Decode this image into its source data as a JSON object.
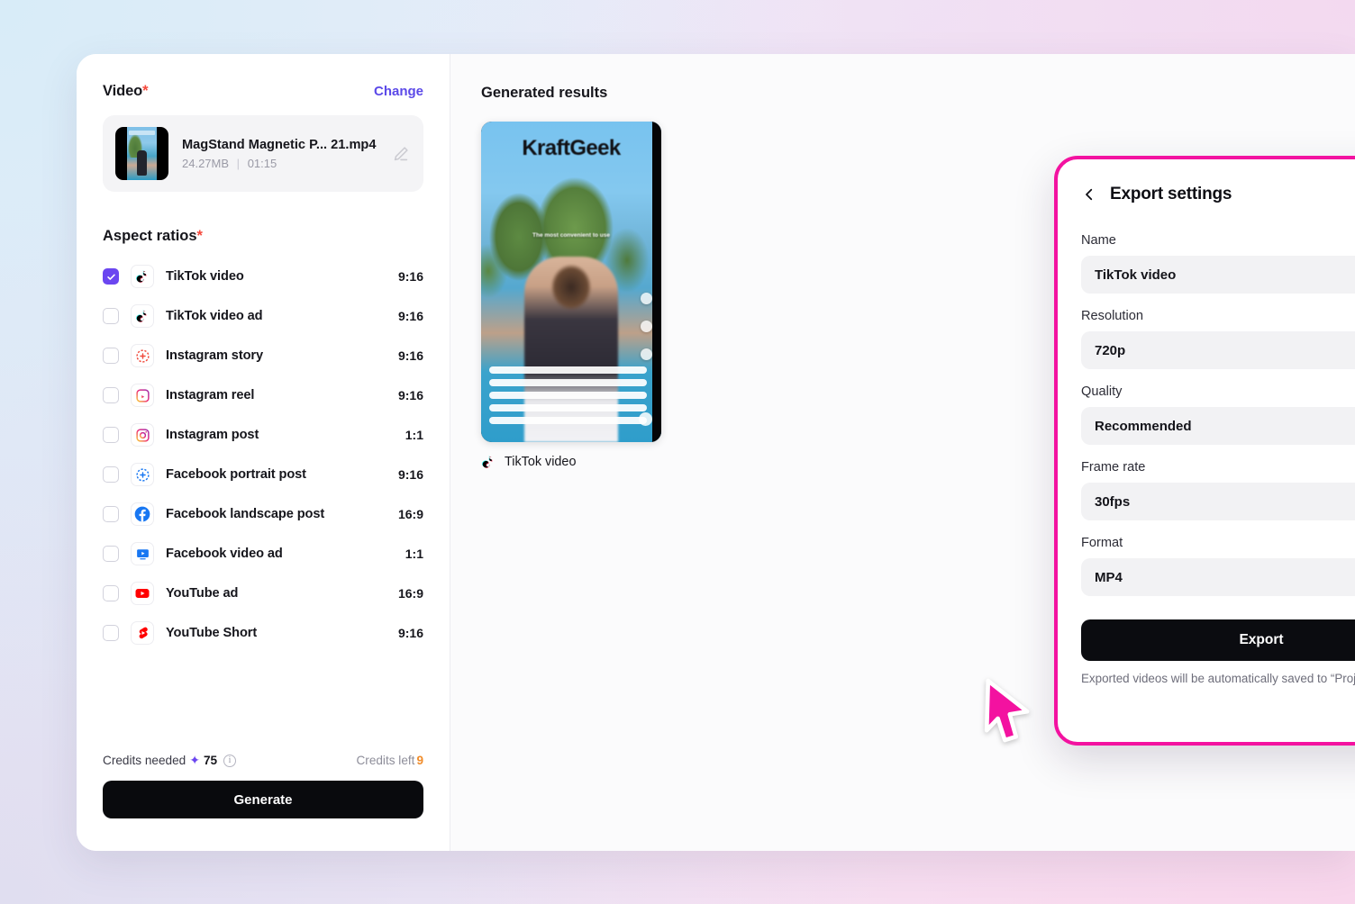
{
  "left_panel": {
    "video_section": {
      "title": "Video",
      "required_mark": "*",
      "change_label": "Change",
      "file": {
        "name": "MagStand Magnetic P...  21.mp4",
        "size": "24.27MB",
        "separator": "|",
        "duration": "01:15",
        "edit_icon": "pencil-icon"
      }
    },
    "aspect_ratios": {
      "title": "Aspect ratios",
      "required_mark": "*",
      "items": [
        {
          "label": "TikTok video",
          "ratio": "9:16",
          "icon": "tiktok-icon",
          "checked": true
        },
        {
          "label": "TikTok video ad",
          "ratio": "9:16",
          "icon": "tiktok-icon",
          "checked": false
        },
        {
          "label": "Instagram story",
          "ratio": "9:16",
          "icon": "instagram-story-icon",
          "checked": false
        },
        {
          "label": "Instagram reel",
          "ratio": "9:16",
          "icon": "instagram-reel-icon",
          "checked": false
        },
        {
          "label": "Instagram post",
          "ratio": "1:1",
          "icon": "instagram-icon",
          "checked": false
        },
        {
          "label": "Facebook portrait post",
          "ratio": "9:16",
          "icon": "facebook-story-icon",
          "checked": false
        },
        {
          "label": "Facebook landscape post",
          "ratio": "16:9",
          "icon": "facebook-icon",
          "checked": false
        },
        {
          "label": "Facebook video ad",
          "ratio": "1:1",
          "icon": "facebook-video-ad-icon",
          "checked": false
        },
        {
          "label": "YouTube ad",
          "ratio": "16:9",
          "icon": "youtube-icon",
          "checked": false
        },
        {
          "label": "YouTube Short",
          "ratio": "9:16",
          "icon": "youtube-shorts-icon",
          "checked": false
        }
      ]
    },
    "footer": {
      "credits_needed_label": "Credits needed",
      "credits_needed_value": "75",
      "credits_left_label": "Credits left",
      "credits_left_value": "9",
      "generate_label": "Generate"
    }
  },
  "right_panel": {
    "title": "Generated results",
    "result": {
      "label": "TikTok video",
      "icon": "tiktok-icon",
      "preview_brand": "KraftGeek",
      "preview_caption": "The most convenient to use"
    }
  },
  "modal": {
    "title": "Export settings",
    "back_icon": "chevron-left-icon",
    "close_icon": "close-icon",
    "fields": [
      {
        "label": "Name",
        "value": "TikTok video",
        "type": "text"
      },
      {
        "label": "Resolution",
        "value": "720p",
        "type": "select"
      },
      {
        "label": "Quality",
        "value": "Recommended",
        "type": "select"
      },
      {
        "label": "Frame rate",
        "value": "30fps",
        "type": "select"
      },
      {
        "label": "Format",
        "value": "MP4",
        "type": "select"
      }
    ],
    "export_label": "Export",
    "footer_note": "Exported videos will be automatically saved to “Projects.”",
    "border_color": "#f312a0"
  },
  "colors": {
    "accent_purple": "#6b46f0",
    "link_purple": "#5b49e8",
    "magenta": "#f312a0",
    "orange": "#f08c2a",
    "dark_button": "#0b0c10"
  }
}
